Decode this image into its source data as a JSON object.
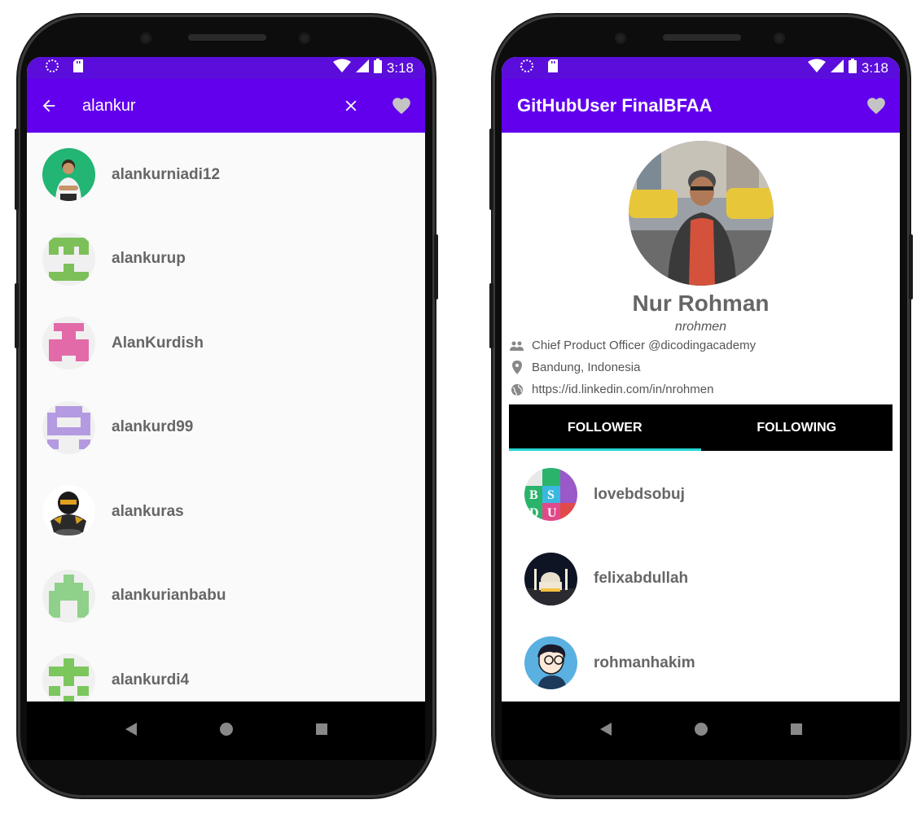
{
  "status": {
    "time": "3:18"
  },
  "search_screen": {
    "query": "alankur",
    "users": [
      {
        "login": "alankurniadi12",
        "avatar": "photo"
      },
      {
        "login": "alankurup",
        "avatar": "identicon",
        "color": "#7dc05a"
      },
      {
        "login": "AlanKurdish",
        "avatar": "identicon",
        "color": "#e26aa8"
      },
      {
        "login": "alankurd99",
        "avatar": "identicon",
        "color": "#b49ae0"
      },
      {
        "login": "alankuras",
        "avatar": "photo"
      },
      {
        "login": "alankurianbabu",
        "avatar": "identicon",
        "color": "#8fd18a"
      },
      {
        "login": "alankurdi4",
        "avatar": "identicon",
        "color": "#7cc65e"
      }
    ]
  },
  "detail_screen": {
    "app_title": "GitHubUser FinalBFAA",
    "name": "Nur Rohman",
    "login": "nrohmen",
    "company": "Chief Product Officer @dicodingacademy",
    "location": "Bandung, Indonesia",
    "blog": "https://id.linkedin.com/in/nrohmen",
    "tabs": [
      "FOLLOWER",
      "FOLLOWING"
    ],
    "followers": [
      {
        "login": "lovebdsobuj"
      },
      {
        "login": "felixabdullah"
      },
      {
        "login": "rohmanhakim"
      }
    ]
  },
  "colors": {
    "primary": "#6200ee",
    "status": "#5a0ddb",
    "accent": "#25d6d6"
  }
}
